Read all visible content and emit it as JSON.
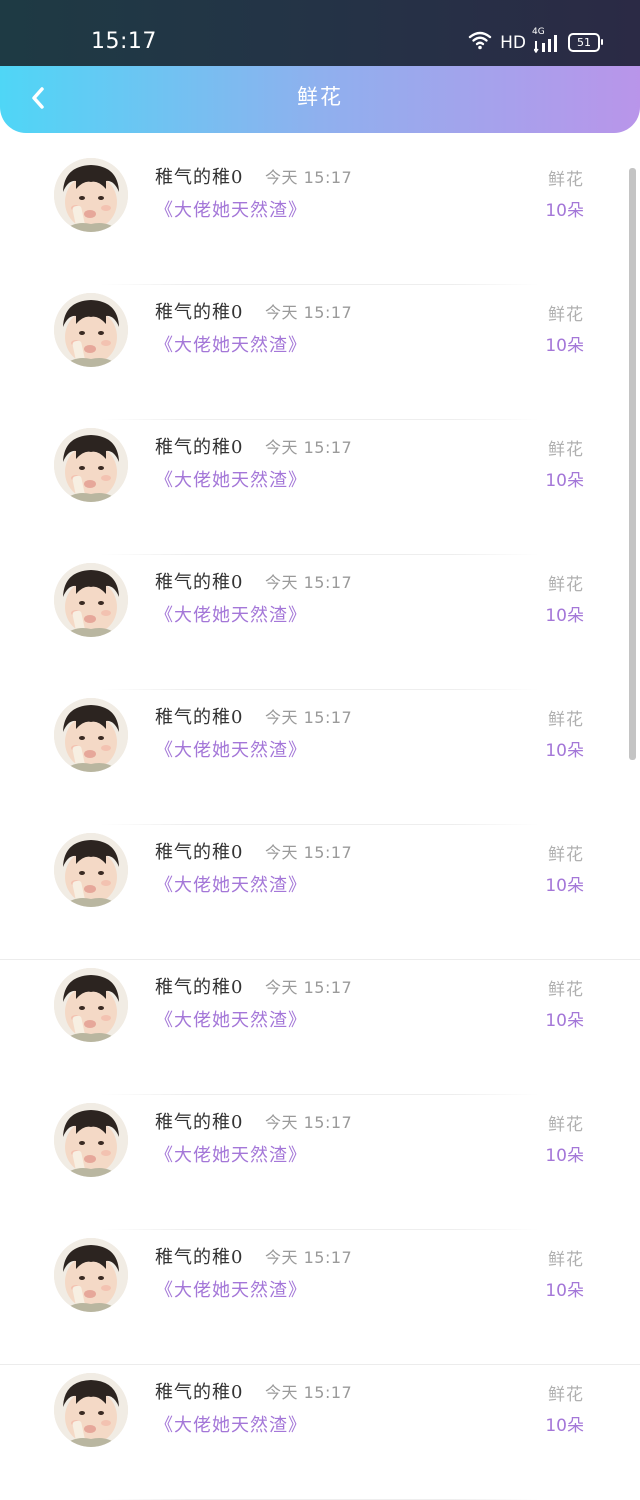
{
  "status_bar": {
    "time": "15:17",
    "network_label": "HD",
    "signal_label": "4G",
    "battery": "51"
  },
  "header": {
    "title": "鲜花",
    "back_icon": "chevron-left-icon"
  },
  "records": [
    {
      "user": "稚气的稚0",
      "time": "今天 15:17",
      "book": "《大佬她天然渣》",
      "gift_type": "鲜花",
      "gift_count": "10朵"
    },
    {
      "user": "稚气的稚0",
      "time": "今天 15:17",
      "book": "《大佬她天然渣》",
      "gift_type": "鲜花",
      "gift_count": "10朵"
    },
    {
      "user": "稚气的稚0",
      "time": "今天 15:17",
      "book": "《大佬她天然渣》",
      "gift_type": "鲜花",
      "gift_count": "10朵"
    },
    {
      "user": "稚气的稚0",
      "time": "今天 15:17",
      "book": "《大佬她天然渣》",
      "gift_type": "鲜花",
      "gift_count": "10朵"
    },
    {
      "user": "稚气的稚0",
      "time": "今天 15:17",
      "book": "《大佬她天然渣》",
      "gift_type": "鲜花",
      "gift_count": "10朵"
    },
    {
      "user": "稚气的稚0",
      "time": "今天 15:17",
      "book": "《大佬她天然渣》",
      "gift_type": "鲜花",
      "gift_count": "10朵"
    },
    {
      "user": "稚气的稚0",
      "time": "今天 15:17",
      "book": "《大佬她天然渣》",
      "gift_type": "鲜花",
      "gift_count": "10朵"
    },
    {
      "user": "稚气的稚0",
      "time": "今天 15:17",
      "book": "《大佬她天然渣》",
      "gift_type": "鲜花",
      "gift_count": "10朵"
    },
    {
      "user": "稚气的稚0",
      "time": "今天 15:17",
      "book": "《大佬她天然渣》",
      "gift_type": "鲜花",
      "gift_count": "10朵"
    },
    {
      "user": "稚气的稚0",
      "time": "今天 15:17",
      "book": "《大佬她天然渣》",
      "gift_type": "鲜花",
      "gift_count": "10朵"
    }
  ],
  "colors": {
    "accent_purple": "#a477d8",
    "header_start": "#4fd6f6",
    "header_end": "#b995ea"
  }
}
